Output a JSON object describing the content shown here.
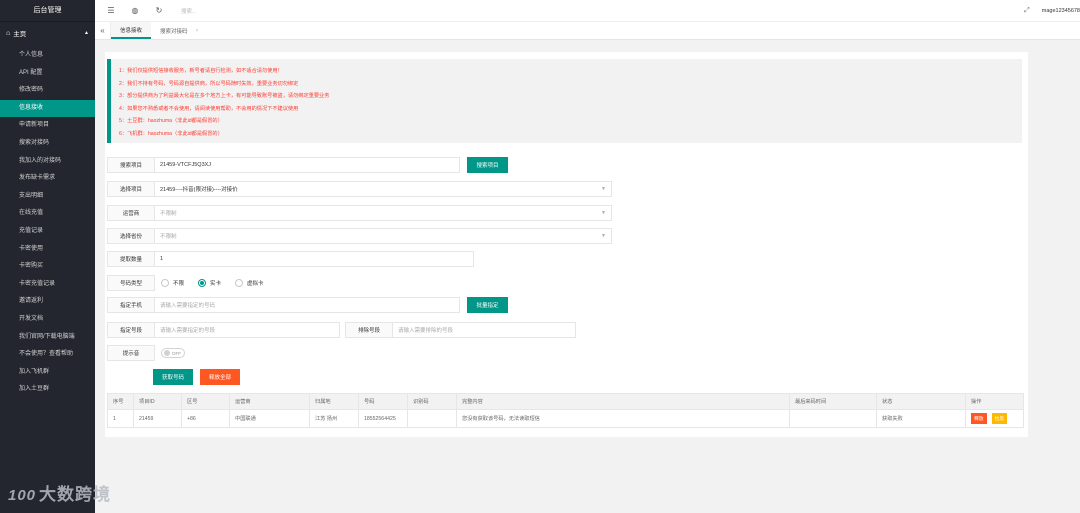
{
  "sidebar": {
    "title": "后台管理",
    "group": "主页",
    "items": [
      "个人信息",
      "API 配置",
      "修改密码",
      "信息接收",
      "申请新项目",
      "搜索对接码",
      "我加入的对接码",
      "发布缺卡需求",
      "支出明细",
      "在线充值",
      "充值记录",
      "卡密使用",
      "卡密购买",
      "卡密充值记录",
      "邀请返利",
      "开发文档",
      "我们官网/下载电脑端",
      "不会使用？查看帮助",
      "加入飞机群",
      "加入土豆群"
    ],
    "active_index": 3
  },
  "watermark": {
    "logo": "100",
    "text": "大数跨境"
  },
  "topbar": {
    "search_placeholder": "搜索...",
    "user": "mage12345678"
  },
  "tabs": [
    {
      "label": "信息接收"
    },
    {
      "label": "搜索对接码",
      "close": "×"
    }
  ],
  "notice": [
    "1：我们仅提供短信接收服务，新号者请自行检测，如不适合请勿使用！",
    "2：我们不持有号码，号码源自提供商，所以号码随时失效，重要业务切勿绑定",
    "3：部分提供商为了利益最大化是在多个地方上卡，有可能导致账号被盗，请勿绑定重要业务",
    "4：如果您不熟悉或者不会使用，请阅读使用帮助，不会用的情况下不建议使用",
    "5：土豆群：haozhuma（非此id都是假冒的）",
    "6：飞机群：haozhuma（非此id都是假冒的）"
  ],
  "form": {
    "search_project": {
      "label": "搜索项目",
      "value": "21459-VTCFJ5Q3XJ",
      "button": "搜索项目"
    },
    "select_project": {
      "label": "选择项目",
      "value": "21459----抖音(限对接)----对接价"
    },
    "operator": {
      "label": "运营商",
      "value": "不限制"
    },
    "province": {
      "label": "选择省份",
      "value": "不限制"
    },
    "quantity": {
      "label": "提取数量",
      "value": "1"
    },
    "number_type": {
      "label": "号码类型",
      "options": [
        "不限",
        "实卡",
        "虚拟卡"
      ],
      "selected": "实卡"
    },
    "phone": {
      "label": "指定手机",
      "placeholder": "请输入需要指定的号码",
      "button": "批量指定"
    },
    "segment": {
      "label": "指定号段",
      "placeholder": "请输入需要指定的号段"
    },
    "exclude": {
      "label": "排除号段",
      "placeholder": "请输入需要排除的号段"
    },
    "sound": {
      "label": "提示音",
      "state": "OFF"
    },
    "get_button": "获取号码",
    "release_all_button": "释放全部"
  },
  "table": {
    "headers": [
      "序号",
      "项目ID",
      "区号",
      "运营商",
      "归属地",
      "号码",
      "识别码",
      "完整内容",
      "最后来码时间",
      "状态",
      "操作"
    ],
    "rows": [
      {
        "cells": [
          "1",
          "21459",
          "+86",
          "中国联通",
          "江苏 扬州",
          "18552564425",
          "",
          "您没有获取该号码，无法读取短信",
          "",
          "获取失败"
        ],
        "actions": [
          "释放",
          "拉黑"
        ]
      }
    ]
  }
}
